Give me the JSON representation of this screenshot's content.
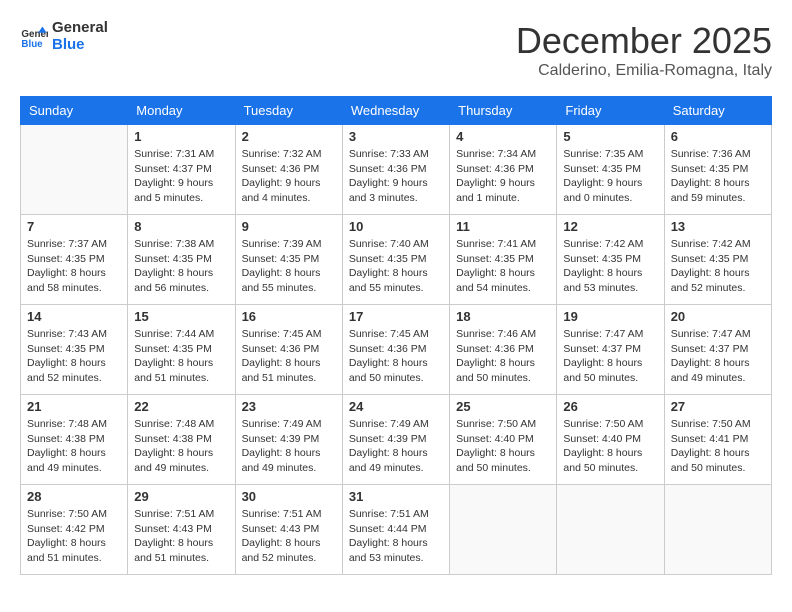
{
  "header": {
    "logo_line1": "General",
    "logo_line2": "Blue",
    "month": "December 2025",
    "location": "Calderino, Emilia-Romagna, Italy"
  },
  "columns": [
    "Sunday",
    "Monday",
    "Tuesday",
    "Wednesday",
    "Thursday",
    "Friday",
    "Saturday"
  ],
  "weeks": [
    [
      {
        "day": "",
        "lines": []
      },
      {
        "day": "1",
        "lines": [
          "Sunrise: 7:31 AM",
          "Sunset: 4:37 PM",
          "Daylight: 9 hours",
          "and 5 minutes."
        ]
      },
      {
        "day": "2",
        "lines": [
          "Sunrise: 7:32 AM",
          "Sunset: 4:36 PM",
          "Daylight: 9 hours",
          "and 4 minutes."
        ]
      },
      {
        "day": "3",
        "lines": [
          "Sunrise: 7:33 AM",
          "Sunset: 4:36 PM",
          "Daylight: 9 hours",
          "and 3 minutes."
        ]
      },
      {
        "day": "4",
        "lines": [
          "Sunrise: 7:34 AM",
          "Sunset: 4:36 PM",
          "Daylight: 9 hours",
          "and 1 minute."
        ]
      },
      {
        "day": "5",
        "lines": [
          "Sunrise: 7:35 AM",
          "Sunset: 4:35 PM",
          "Daylight: 9 hours",
          "and 0 minutes."
        ]
      },
      {
        "day": "6",
        "lines": [
          "Sunrise: 7:36 AM",
          "Sunset: 4:35 PM",
          "Daylight: 8 hours",
          "and 59 minutes."
        ]
      }
    ],
    [
      {
        "day": "7",
        "lines": [
          "Sunrise: 7:37 AM",
          "Sunset: 4:35 PM",
          "Daylight: 8 hours",
          "and 58 minutes."
        ]
      },
      {
        "day": "8",
        "lines": [
          "Sunrise: 7:38 AM",
          "Sunset: 4:35 PM",
          "Daylight: 8 hours",
          "and 56 minutes."
        ]
      },
      {
        "day": "9",
        "lines": [
          "Sunrise: 7:39 AM",
          "Sunset: 4:35 PM",
          "Daylight: 8 hours",
          "and 55 minutes."
        ]
      },
      {
        "day": "10",
        "lines": [
          "Sunrise: 7:40 AM",
          "Sunset: 4:35 PM",
          "Daylight: 8 hours",
          "and 55 minutes."
        ]
      },
      {
        "day": "11",
        "lines": [
          "Sunrise: 7:41 AM",
          "Sunset: 4:35 PM",
          "Daylight: 8 hours",
          "and 54 minutes."
        ]
      },
      {
        "day": "12",
        "lines": [
          "Sunrise: 7:42 AM",
          "Sunset: 4:35 PM",
          "Daylight: 8 hours",
          "and 53 minutes."
        ]
      },
      {
        "day": "13",
        "lines": [
          "Sunrise: 7:42 AM",
          "Sunset: 4:35 PM",
          "Daylight: 8 hours",
          "and 52 minutes."
        ]
      }
    ],
    [
      {
        "day": "14",
        "lines": [
          "Sunrise: 7:43 AM",
          "Sunset: 4:35 PM",
          "Daylight: 8 hours",
          "and 52 minutes."
        ]
      },
      {
        "day": "15",
        "lines": [
          "Sunrise: 7:44 AM",
          "Sunset: 4:35 PM",
          "Daylight: 8 hours",
          "and 51 minutes."
        ]
      },
      {
        "day": "16",
        "lines": [
          "Sunrise: 7:45 AM",
          "Sunset: 4:36 PM",
          "Daylight: 8 hours",
          "and 51 minutes."
        ]
      },
      {
        "day": "17",
        "lines": [
          "Sunrise: 7:45 AM",
          "Sunset: 4:36 PM",
          "Daylight: 8 hours",
          "and 50 minutes."
        ]
      },
      {
        "day": "18",
        "lines": [
          "Sunrise: 7:46 AM",
          "Sunset: 4:36 PM",
          "Daylight: 8 hours",
          "and 50 minutes."
        ]
      },
      {
        "day": "19",
        "lines": [
          "Sunrise: 7:47 AM",
          "Sunset: 4:37 PM",
          "Daylight: 8 hours",
          "and 50 minutes."
        ]
      },
      {
        "day": "20",
        "lines": [
          "Sunrise: 7:47 AM",
          "Sunset: 4:37 PM",
          "Daylight: 8 hours",
          "and 49 minutes."
        ]
      }
    ],
    [
      {
        "day": "21",
        "lines": [
          "Sunrise: 7:48 AM",
          "Sunset: 4:38 PM",
          "Daylight: 8 hours",
          "and 49 minutes."
        ]
      },
      {
        "day": "22",
        "lines": [
          "Sunrise: 7:48 AM",
          "Sunset: 4:38 PM",
          "Daylight: 8 hours",
          "and 49 minutes."
        ]
      },
      {
        "day": "23",
        "lines": [
          "Sunrise: 7:49 AM",
          "Sunset: 4:39 PM",
          "Daylight: 8 hours",
          "and 49 minutes."
        ]
      },
      {
        "day": "24",
        "lines": [
          "Sunrise: 7:49 AM",
          "Sunset: 4:39 PM",
          "Daylight: 8 hours",
          "and 49 minutes."
        ]
      },
      {
        "day": "25",
        "lines": [
          "Sunrise: 7:50 AM",
          "Sunset: 4:40 PM",
          "Daylight: 8 hours",
          "and 50 minutes."
        ]
      },
      {
        "day": "26",
        "lines": [
          "Sunrise: 7:50 AM",
          "Sunset: 4:40 PM",
          "Daylight: 8 hours",
          "and 50 minutes."
        ]
      },
      {
        "day": "27",
        "lines": [
          "Sunrise: 7:50 AM",
          "Sunset: 4:41 PM",
          "Daylight: 8 hours",
          "and 50 minutes."
        ]
      }
    ],
    [
      {
        "day": "28",
        "lines": [
          "Sunrise: 7:50 AM",
          "Sunset: 4:42 PM",
          "Daylight: 8 hours",
          "and 51 minutes."
        ]
      },
      {
        "day": "29",
        "lines": [
          "Sunrise: 7:51 AM",
          "Sunset: 4:43 PM",
          "Daylight: 8 hours",
          "and 51 minutes."
        ]
      },
      {
        "day": "30",
        "lines": [
          "Sunrise: 7:51 AM",
          "Sunset: 4:43 PM",
          "Daylight: 8 hours",
          "and 52 minutes."
        ]
      },
      {
        "day": "31",
        "lines": [
          "Sunrise: 7:51 AM",
          "Sunset: 4:44 PM",
          "Daylight: 8 hours",
          "and 53 minutes."
        ]
      },
      {
        "day": "",
        "lines": []
      },
      {
        "day": "",
        "lines": []
      },
      {
        "day": "",
        "lines": []
      }
    ]
  ]
}
